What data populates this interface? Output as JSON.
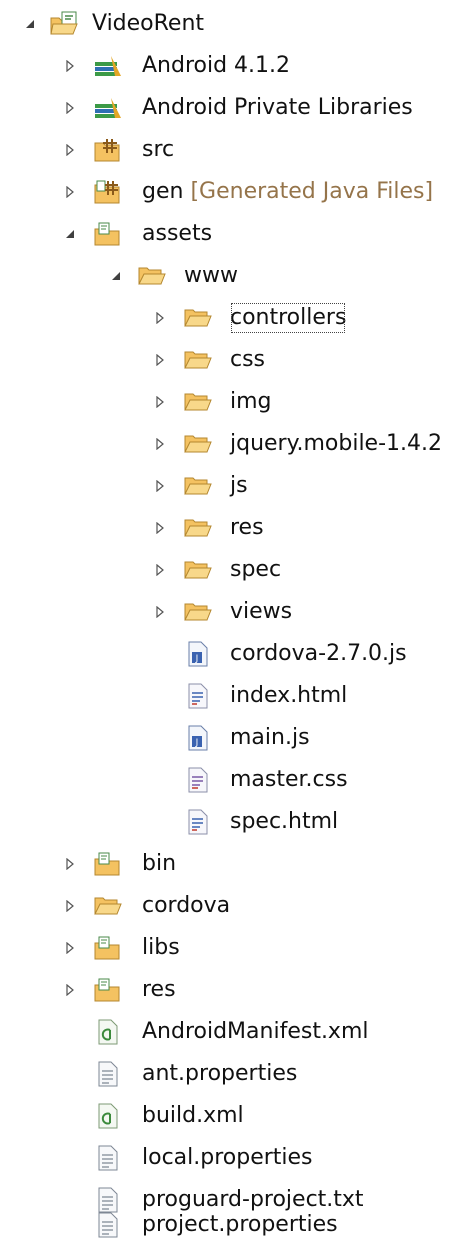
{
  "project": {
    "name": "VideoRent",
    "items": [
      {
        "label": "Android 4.1.2"
      },
      {
        "label": "Android Private Libraries"
      },
      {
        "label": "src"
      },
      {
        "label": "gen",
        "decoration": "[Generated Java Files]"
      },
      {
        "label": "assets"
      },
      {
        "label": "www"
      },
      {
        "label": "controllers"
      },
      {
        "label": "css"
      },
      {
        "label": "img"
      },
      {
        "label": "jquery.mobile-1.4.2"
      },
      {
        "label": "js"
      },
      {
        "label": "res"
      },
      {
        "label": "spec"
      },
      {
        "label": "views"
      },
      {
        "label": "cordova-2.7.0.js"
      },
      {
        "label": "index.html"
      },
      {
        "label": "main.js"
      },
      {
        "label": "master.css"
      },
      {
        "label": "spec.html"
      },
      {
        "label": "bin"
      },
      {
        "label": "cordova"
      },
      {
        "label": "libs"
      },
      {
        "label": "res"
      },
      {
        "label": "AndroidManifest.xml"
      },
      {
        "label": "ant.properties"
      },
      {
        "label": "build.xml"
      },
      {
        "label": "local.properties"
      },
      {
        "label": "proguard-project.txt"
      },
      {
        "label": "project.properties"
      }
    ]
  },
  "icons": {
    "twisty_collapsed": "triangle-right-outline",
    "twisty_expanded": "triangle-down-filled",
    "project": "android-project-icon",
    "library": "library-container-icon",
    "source_folder": "source-package-folder-icon",
    "resource_folder": "resource-folder-icon",
    "folder": "folder-icon",
    "js_file": "javascript-file-icon",
    "html_file": "html-file-icon",
    "css_file": "css-file-icon",
    "xml_file": "xml-file-icon",
    "text_file": "text-file-icon"
  },
  "colors": {
    "folder": "#f4c261",
    "folder_stroke": "#b4872f",
    "decoration": "#95744a",
    "library_green": "#3c9a47",
    "library_gold": "#e3a626"
  }
}
